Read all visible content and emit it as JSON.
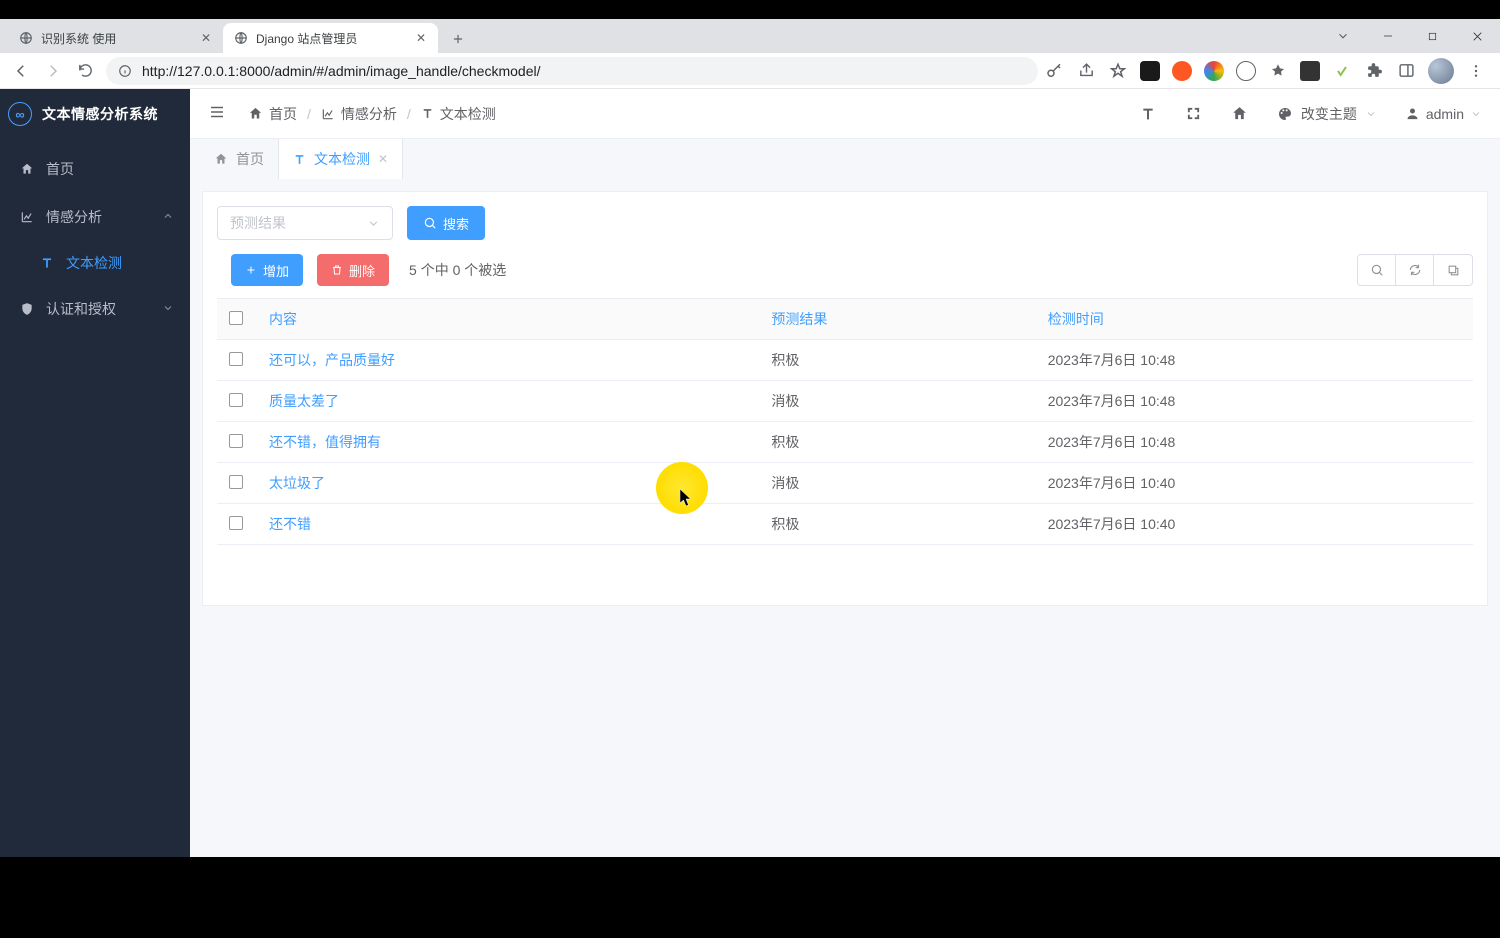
{
  "browser": {
    "tabs": [
      {
        "title": "识别系统 使用",
        "active": false
      },
      {
        "title": "Django 站点管理员",
        "active": true
      }
    ],
    "url": "http://127.0.0.1:8000/admin/#/admin/image_handle/checkmodel/"
  },
  "app": {
    "title": "文本情感分析系统",
    "sidebar": {
      "home": "首页",
      "analysis": "情感分析",
      "text_detect": "文本检测",
      "auth": "认证和授权"
    },
    "header": {
      "crumb_home": "首页",
      "crumb_analysis": "情感分析",
      "crumb_text_detect": "文本检测",
      "theme_label": "改变主题",
      "user": "admin"
    },
    "page_tabs": {
      "home": "首页",
      "text_detect": "文本检测"
    },
    "filter": {
      "select_placeholder": "预测结果",
      "search": "搜索"
    },
    "toolbar": {
      "add": "增加",
      "delete": "删除",
      "selection_text": "5 个中 0 个被选"
    },
    "columns": {
      "content": "内容",
      "result": "预测结果",
      "time": "检测时间"
    },
    "rows": [
      {
        "content": "还可以，产品质量好",
        "result": "积极",
        "time": "2023年7月6日 10:48"
      },
      {
        "content": "质量太差了",
        "result": "消极",
        "time": "2023年7月6日 10:48"
      },
      {
        "content": "还不错，值得拥有",
        "result": "积极",
        "time": "2023年7月6日 10:48"
      },
      {
        "content": "太垃圾了",
        "result": "消极",
        "time": "2023年7月6日 10:40"
      },
      {
        "content": "还不错",
        "result": "积极",
        "time": "2023年7月6日 10:40"
      }
    ]
  }
}
